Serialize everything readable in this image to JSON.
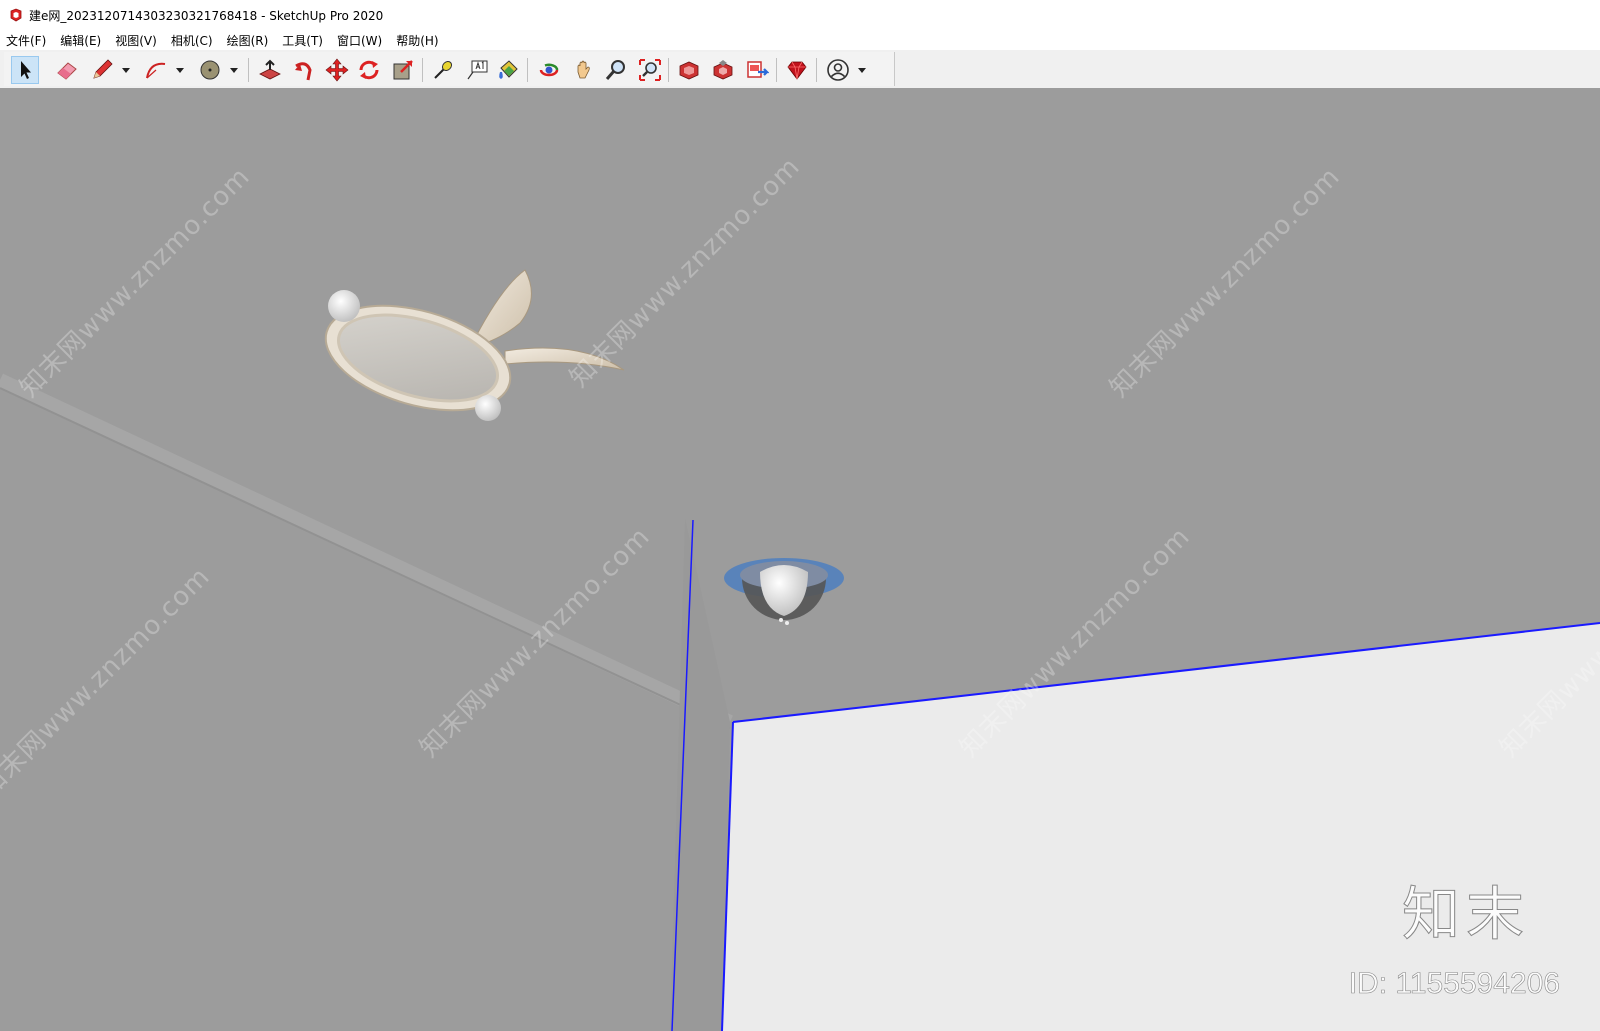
{
  "window": {
    "title": "建e网_20231207143032303217684​18 - SketchUp Pro 2020",
    "app_icon": "sketchup-icon"
  },
  "menubar": {
    "items": [
      {
        "label": "文件(F)"
      },
      {
        "label": "编辑(E)"
      },
      {
        "label": "视图(V)"
      },
      {
        "label": "相机(C)"
      },
      {
        "label": "绘图(R)"
      },
      {
        "label": "工具(T)"
      },
      {
        "label": "窗口(W)"
      },
      {
        "label": "帮助(H)"
      }
    ]
  },
  "toolbar": {
    "tools": [
      {
        "name": "select-icon",
        "active": true
      },
      {
        "name": "eraser-icon"
      },
      {
        "name": "pencil-icon"
      },
      {
        "name": "arc-icon"
      },
      {
        "name": "shape-icon"
      },
      {
        "name": "push-pull-icon"
      },
      {
        "name": "follow-me-icon"
      },
      {
        "name": "move-icon"
      },
      {
        "name": "rotate-icon"
      },
      {
        "name": "scale-icon"
      },
      {
        "name": "tape-measure-icon"
      },
      {
        "name": "text-icon"
      },
      {
        "name": "paint-bucket-icon"
      },
      {
        "name": "orbit-icon"
      },
      {
        "name": "pan-icon"
      },
      {
        "name": "zoom-icon"
      },
      {
        "name": "zoom-extents-icon"
      },
      {
        "name": "warehouse-icon"
      },
      {
        "name": "extension-warehouse-icon"
      },
      {
        "name": "layout-icon"
      },
      {
        "name": "ruby-console-icon"
      },
      {
        "name": "account-icon"
      }
    ]
  },
  "watermarks": {
    "text": "知末网www.znzmo.com",
    "brand": "知末",
    "id_text": "ID: 1155594206"
  },
  "colors": {
    "viewport_bg": "#9c9c9c",
    "wall_face": "#ebebeb",
    "edge_blue": "#1a1aff",
    "fixture": "#e6ded2",
    "selection_ring": "#4e7fbf"
  }
}
